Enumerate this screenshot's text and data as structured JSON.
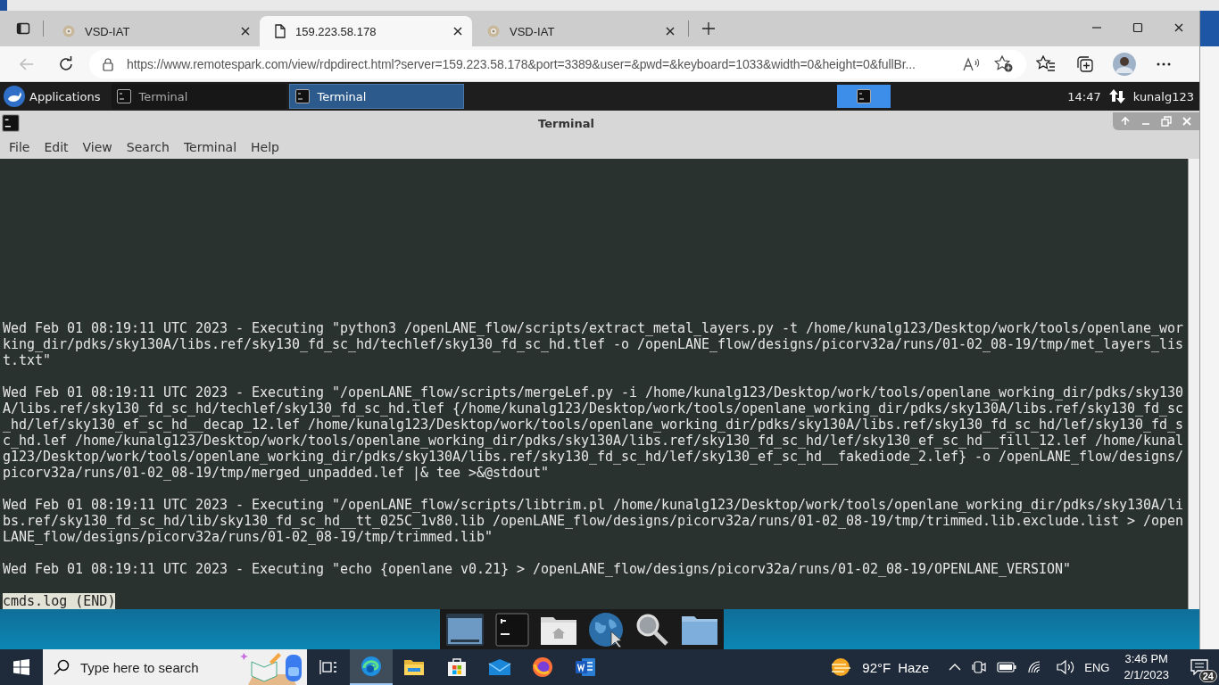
{
  "browser": {
    "tabs": [
      {
        "title": "VSD-IAT",
        "selected": false
      },
      {
        "title": "159.223.58.178",
        "selected": true
      },
      {
        "title": "VSD-IAT",
        "selected": false
      }
    ],
    "address": "https://www.remotespark.com/view/rdpdirect.html?server=159.223.58.178&port=3389&user=&pwd=&keyboard=1033&width=0&height=0&fullBr..."
  },
  "panel": {
    "menu": "Applications",
    "tasks": [
      {
        "label": "Terminal",
        "selected": false
      },
      {
        "label": "Terminal",
        "selected": true
      }
    ],
    "clock": "14:47",
    "user": "kunalg123"
  },
  "terminal": {
    "title": "Terminal",
    "menu": [
      "File",
      "Edit",
      "View",
      "Search",
      "Terminal",
      "Help"
    ],
    "entries": [
      {
        "lines": [
          "Wed Feb 01 08:19:11 UTC 2023 - Executing \"python3 /openLANE_flow/scripts/extract_metal_layers.py -t /home/kunalg123/Desktop/work/tools/openlane_wor",
          "king_dir/pdks/sky130A/libs.ref/sky130_fd_sc_hd/techlef/sky130_fd_sc_hd.tlef -o /openLANE_flow/designs/picorv32a/runs/01-02_08-19/tmp/met_layers_lis",
          "t.txt\""
        ]
      },
      {
        "lines": [
          "Wed Feb 01 08:19:11 UTC 2023 - Executing \"/openLANE_flow/scripts/mergeLef.py -i /home/kunalg123/Desktop/work/tools/openlane_working_dir/pdks/sky130",
          "A/libs.ref/sky130_fd_sc_hd/techlef/sky130_fd_sc_hd.tlef {/home/kunalg123/Desktop/work/tools/openlane_working_dir/pdks/sky130A/libs.ref/sky130_fd_sc",
          "_hd/lef/sky130_ef_sc_hd__decap_12.lef /home/kunalg123/Desktop/work/tools/openlane_working_dir/pdks/sky130A/libs.ref/sky130_fd_sc_hd/lef/sky130_fd_s",
          "c_hd.lef /home/kunalg123/Desktop/work/tools/openlane_working_dir/pdks/sky130A/libs.ref/sky130_fd_sc_hd/lef/sky130_ef_sc_hd__fill_12.lef /home/kunal",
          "g123/Desktop/work/tools/openlane_working_dir/pdks/sky130A/libs.ref/sky130_fd_sc_hd/lef/sky130_ef_sc_hd__fakediode_2.lef} -o /openLANE_flow/designs/",
          "picorv32a/runs/01-02_08-19/tmp/merged_unpadded.lef |& tee >&@stdout\""
        ]
      },
      {
        "lines": [
          "Wed Feb 01 08:19:11 UTC 2023 - Executing \"/openLANE_flow/scripts/libtrim.pl /home/kunalg123/Desktop/work/tools/openlane_working_dir/pdks/sky130A/li",
          "bs.ref/sky130_fd_sc_hd/lib/sky130_fd_sc_hd__tt_025C_1v80.lib /openLANE_flow/designs/picorv32a/runs/01-02_08-19/tmp/trimmed.lib.exclude.list > /open",
          "LANE_flow/designs/picorv32a/runs/01-02_08-19/tmp/trimmed.lib\""
        ]
      },
      {
        "lines": [
          "Wed Feb 01 08:19:11 UTC 2023 - Executing \"echo {openlane v0.21} > /openLANE_flow/designs/picorv32a/runs/01-02_08-19/OPENLANE_VERSION\""
        ]
      }
    ],
    "status": "cmds.log (END)"
  },
  "taskbar": {
    "search_placeholder": "Type here to search",
    "apps": [
      {
        "kind": "taskview",
        "selected": false
      },
      {
        "kind": "browser",
        "selected": true
      },
      {
        "kind": "folder",
        "selected": false
      },
      {
        "kind": "store",
        "selected": false
      },
      {
        "kind": "mail",
        "selected": false
      },
      {
        "kind": "firefox",
        "selected": false
      },
      {
        "kind": "word",
        "selected": false
      }
    ],
    "temperature": "92°F",
    "weather": "Haze",
    "language": "ENG",
    "time": "3:46 PM",
    "date": "2/1/2023",
    "notifications": "24"
  }
}
